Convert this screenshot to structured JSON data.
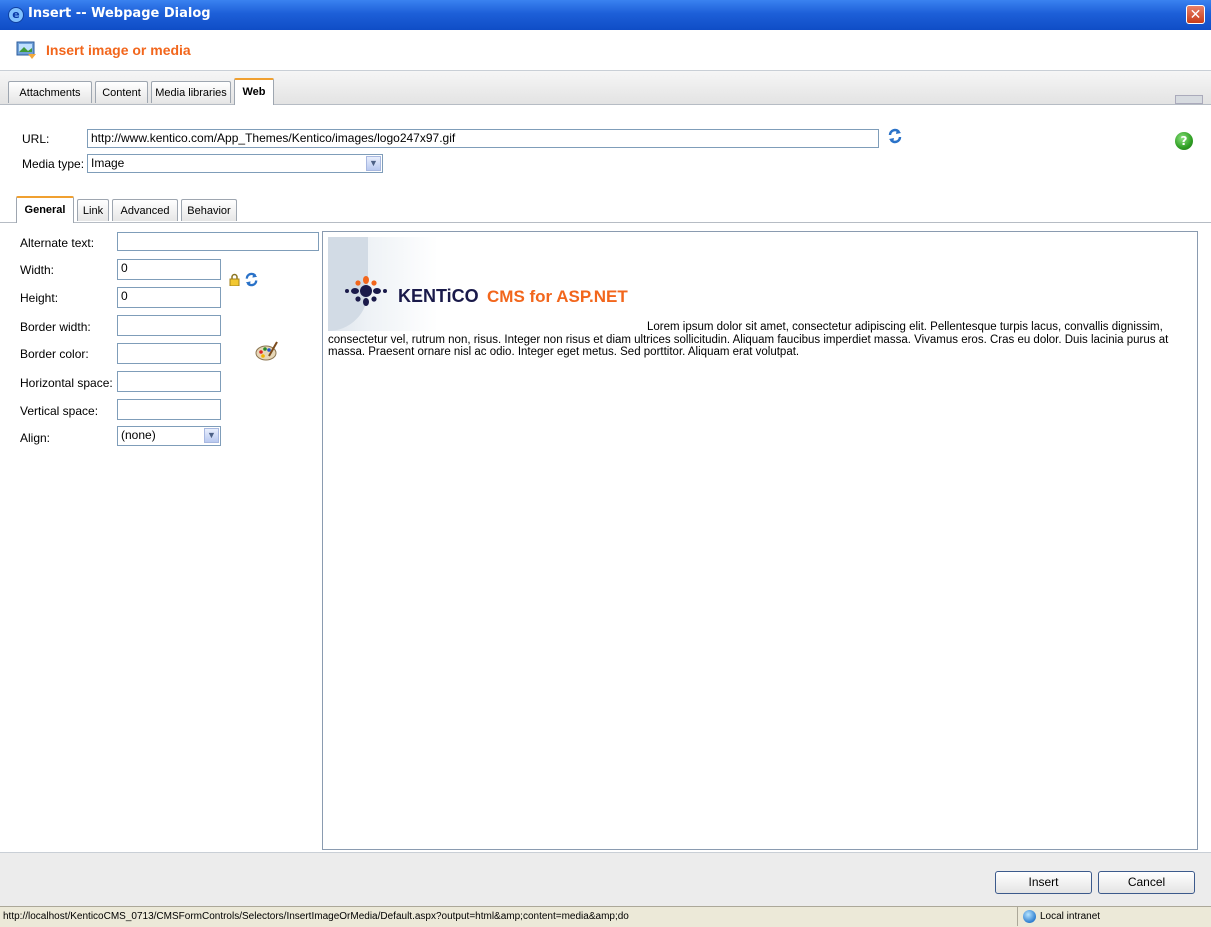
{
  "window": {
    "title": "Insert -- Webpage Dialog",
    "close_glyph": "✕"
  },
  "header": {
    "title": "Insert image or media",
    "icon": "insert-media-icon"
  },
  "main_tabs": [
    {
      "label": "Attachments",
      "active": false
    },
    {
      "label": "Content",
      "active": false
    },
    {
      "label": "Media libraries",
      "active": false
    },
    {
      "label": "Web",
      "active": true
    }
  ],
  "url_panel": {
    "url_label": "URL:",
    "url_value": "http://www.kentico.com/App_Themes/Kentico/images/logo247x97.gif",
    "media_type_label": "Media type:",
    "media_type_value": "Image",
    "help_glyph": "?"
  },
  "sub_tabs": [
    {
      "label": "General",
      "active": true
    },
    {
      "label": "Link",
      "active": false
    },
    {
      "label": "Advanced",
      "active": false
    },
    {
      "label": "Behavior",
      "active": false
    }
  ],
  "general": {
    "alternate_text_label": "Alternate text:",
    "alternate_text_value": "",
    "width_label": "Width:",
    "width_value": "0",
    "height_label": "Height:",
    "height_value": "0",
    "border_width_label": "Border width:",
    "border_width_value": "",
    "border_color_label": "Border color:",
    "border_color_value": "",
    "hspace_label": "Horizontal space:",
    "hspace_value": "",
    "vspace_label": "Vertical space:",
    "vspace_value": "",
    "align_label": "Align:",
    "align_value": "(none)"
  },
  "preview": {
    "logo_brand": "KENTiCO",
    "logo_cms": "CMS for ASP.NET",
    "lorem": "Lorem ipsum dolor sit amet, consectetur adipiscing elit. Pellentesque turpis lacus, convallis dignissim, consectetur vel, rutrum non, risus. Integer non risus et diam ultrices sollicitudin. Aliquam faucibus imperdiet massa. Vivamus eros. Cras eu dolor. Duis lacinia purus at massa. Praesent ornare nisl ac odio. Integer eget metus. Sed porttitor. Aliquam erat volutpat."
  },
  "footer": {
    "insert_label": "Insert",
    "cancel_label": "Cancel"
  },
  "statusbar": {
    "url": "http://localhost/KenticoCMS_0713/CMSFormControls/Selectors/InsertImageOrMedia/Default.aspx?output=html&amp;content=media&amp;do",
    "zone": "Local intranet"
  },
  "colors": {
    "accent_orange": "#f2661c",
    "titlebar_blue": "#1d5fd8",
    "help_green": "#2f9e23"
  }
}
